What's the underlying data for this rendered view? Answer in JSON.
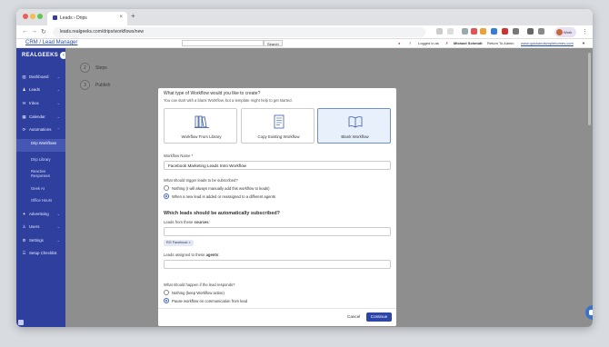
{
  "browser": {
    "tab_title": "Leads › Drips",
    "url": "leads.realgeeks.com/drips/workflows/new",
    "profile_label": "Work"
  },
  "topbar": {
    "crm_link": "CRM / Lead Manager",
    "search_button": "Search",
    "logged_in_as": "Logged in as",
    "user_name": "Michael Schmidt",
    "return_to_admin": "Return To Admin",
    "site_link": "www.quickandsimplehomes.com"
  },
  "sidebar": {
    "logo": "REALGEEKS",
    "items": [
      {
        "label": "Dashboard",
        "icon": "dashboard-icon",
        "glyph": "▥"
      },
      {
        "label": "Leads",
        "icon": "leads-icon",
        "glyph": "♟"
      },
      {
        "label": "Inbox",
        "icon": "inbox-icon",
        "glyph": "✉"
      },
      {
        "label": "Calendar",
        "icon": "calendar-icon",
        "glyph": "▦"
      },
      {
        "label": "Automations",
        "icon": "automations-icon",
        "glyph": "⟳"
      }
    ],
    "sub_items": [
      {
        "label": "Drip Workflows",
        "active": true
      },
      {
        "label": "Drip Library",
        "active": false
      },
      {
        "label": "Reactive Responses",
        "active": false
      },
      {
        "label": "Geek AI",
        "active": false
      },
      {
        "label": "Office Hours",
        "active": false
      }
    ],
    "items_bottom": [
      {
        "label": "Advertising",
        "icon": "advertising-icon",
        "glyph": "✦"
      },
      {
        "label": "Users",
        "icon": "users-icon",
        "glyph": "♙"
      },
      {
        "label": "Settings",
        "icon": "settings-icon",
        "glyph": "⚙"
      },
      {
        "label": "Setup Checklist",
        "icon": "checklist-icon",
        "glyph": "☰"
      }
    ]
  },
  "steps": [
    {
      "num": "2",
      "label": "Steps"
    },
    {
      "num": "3",
      "label": "Publish"
    }
  ],
  "modal": {
    "question": "What type of Workflow would you like to create?",
    "subtext": "You can start with a blank Workflow, but a template might help to get started.",
    "options": [
      {
        "label": "Workflow From Library",
        "icon": "library-icon",
        "selected": false
      },
      {
        "label": "Copy Existing Workflow",
        "icon": "copy-document-icon",
        "selected": false
      },
      {
        "label": "Blank Workflow",
        "icon": "open-book-icon",
        "selected": true
      }
    ],
    "workflow_name_label": "Workflow Name *",
    "workflow_name_value": "Facebook Marketing Leads Intro Workflow",
    "trigger_question": "What should trigger leads to be subscribed?",
    "trigger_options": [
      {
        "label": "Nothing (I will always manually add this workflow to leads)",
        "checked": false
      },
      {
        "label": "When a new lead is added or reassigned to a different agents",
        "checked": true
      }
    ],
    "auto_subscribe_title": "Which leads should be automatically subscribed?",
    "sources_label_prefix": "Leads from these ",
    "sources_label_bold": "sources",
    "sources_label_suffix": ":",
    "source_tag": "RG Facebook",
    "agents_label_prefix": "Leads assigned to these ",
    "agents_label_bold": "agents",
    "agents_label_suffix": ":",
    "responds_question": "What should happen if the lead responds?",
    "respond_options": [
      {
        "label": "Nothing (keep Workflow active)",
        "checked": false
      },
      {
        "label": "Pause workflow on communication from lead",
        "checked": true
      }
    ],
    "cancel_label": "Cancel",
    "continue_label": "Continue"
  },
  "colors": {
    "sidebar": "#2e3f9e",
    "primary_button": "#2e45a8",
    "selected_card": "#e8f0fb"
  }
}
